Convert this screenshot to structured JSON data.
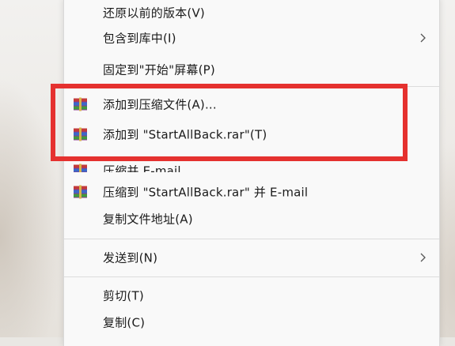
{
  "menu": {
    "items": [
      {
        "id": "restore",
        "label": "还原以前的版本(V)",
        "icon": "",
        "submenu": false
      },
      {
        "id": "include-library",
        "label": "包含到库中(I)",
        "icon": "",
        "submenu": true
      },
      {
        "id": "pin-start",
        "label": "固定到\"开始\"屏幕(P)",
        "icon": "",
        "submenu": false
      },
      {
        "id": "add-archive",
        "label": "添加到压缩文件(A)...",
        "icon": "winrar-icon",
        "submenu": false
      },
      {
        "id": "add-rar",
        "label": "添加到 \"StartAllBack.rar\"(T)",
        "icon": "winrar-icon",
        "submenu": false
      },
      {
        "id": "compress-email",
        "label": "压缩并 E-mail...",
        "icon": "winrar-icon",
        "submenu": false
      },
      {
        "id": "compress-rar-email",
        "label": "压缩到 \"StartAllBack.rar\" 并 E-mail",
        "icon": "winrar-icon",
        "submenu": false
      },
      {
        "id": "copy-path",
        "label": "复制文件地址(A)",
        "icon": "",
        "submenu": false
      },
      {
        "id": "send-to",
        "label": "发送到(N)",
        "icon": "",
        "submenu": true
      },
      {
        "id": "cut",
        "label": "剪切(T)",
        "icon": "",
        "submenu": false
      },
      {
        "id": "copy",
        "label": "复制(C)",
        "icon": "",
        "submenu": false
      }
    ]
  },
  "colors": {
    "highlight_border": "#e5312f",
    "menu_background": "#f9f9f9",
    "text": "#1b1b1b"
  }
}
